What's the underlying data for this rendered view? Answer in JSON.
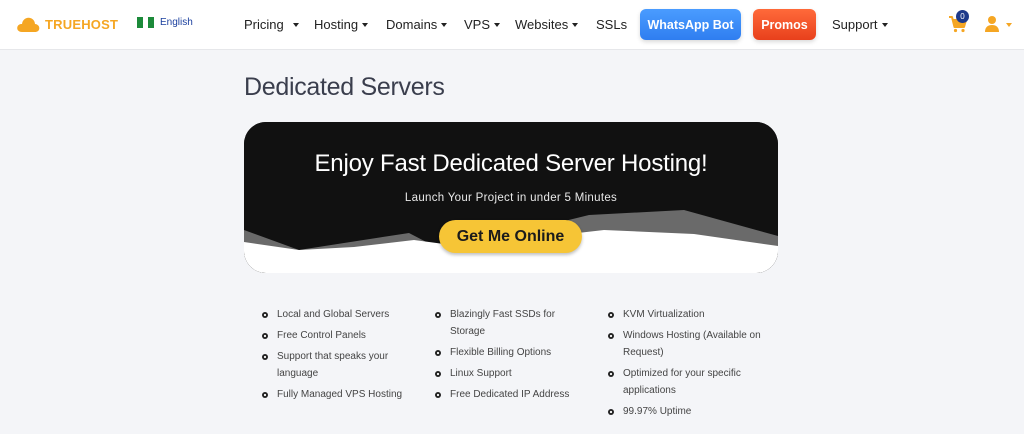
{
  "header": {
    "brand": "TRUEHOST",
    "language": "English",
    "nav": [
      {
        "label": "Pricing"
      },
      {
        "label": "Hosting"
      },
      {
        "label": "Domains"
      },
      {
        "label": "VPS"
      },
      {
        "label": "Websites"
      },
      {
        "label": "SSLs"
      }
    ],
    "whatsapp_label": "WhatsApp Bot",
    "promos_label": "Promos",
    "support_label": "Support",
    "cart_count": "0"
  },
  "colors": {
    "brand": "#f5a623",
    "whatsapp": "#3b8cf7",
    "promos": "#f0532a",
    "cta": "#f6c536",
    "hero_bg": "#111111"
  },
  "page": {
    "title": "Dedicated Servers"
  },
  "hero": {
    "title": "Enjoy Fast Dedicated Server Hosting!",
    "subtitle": "Launch Your Project in under 5 Minutes",
    "cta_label": "Get Me Online"
  },
  "features": {
    "col1": [
      "Local and Global Servers",
      "Free Control Panels",
      "Support that speaks your language",
      "Fully Managed VPS Hosting"
    ],
    "col2": [
      "Blazingly Fast SSDs for Storage",
      "Flexible Billing Options",
      "Linux Support",
      "Free Dedicated IP Address"
    ],
    "col3": [
      "KVM Virtualization",
      "Windows Hosting (Available on Request)",
      "Optimized for your specific applications",
      "99.97% Uptime"
    ]
  }
}
